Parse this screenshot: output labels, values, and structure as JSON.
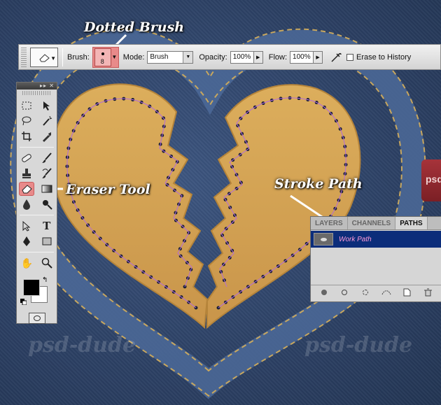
{
  "callouts": {
    "dotted_brush": "Dotted Brush",
    "eraser_tool": "Eraser Tool",
    "stroke_path": "Stroke Path"
  },
  "watermarks": [
    "psd-dude",
    "psd-dude"
  ],
  "red_tag_text": "psd",
  "options_bar": {
    "brush_label": "Brush:",
    "brush_size": "8",
    "mode_label": "Mode:",
    "mode_value": "Brush",
    "opacity_label": "Opacity:",
    "opacity_value": "100%",
    "flow_label": "Flow:",
    "flow_value": "100%",
    "erase_history_label": "Erase to History"
  },
  "tools_panel": {
    "titlebar_controls": "▸▸ ✕",
    "active_tool": "eraser-tool",
    "foreground_color": "#000000",
    "background_color": "#ffffff"
  },
  "paths_panel": {
    "tabs": [
      "LAYERS",
      "CHANNELS",
      "PATHS"
    ],
    "active_tab": "PATHS",
    "path_name": "Work Path"
  },
  "colors": {
    "denim": "#2f4468",
    "leather": "#d4a24e",
    "highlight": "#e88a8a",
    "selection": "#0c2d7a",
    "path_name": "#ff9bd8"
  }
}
